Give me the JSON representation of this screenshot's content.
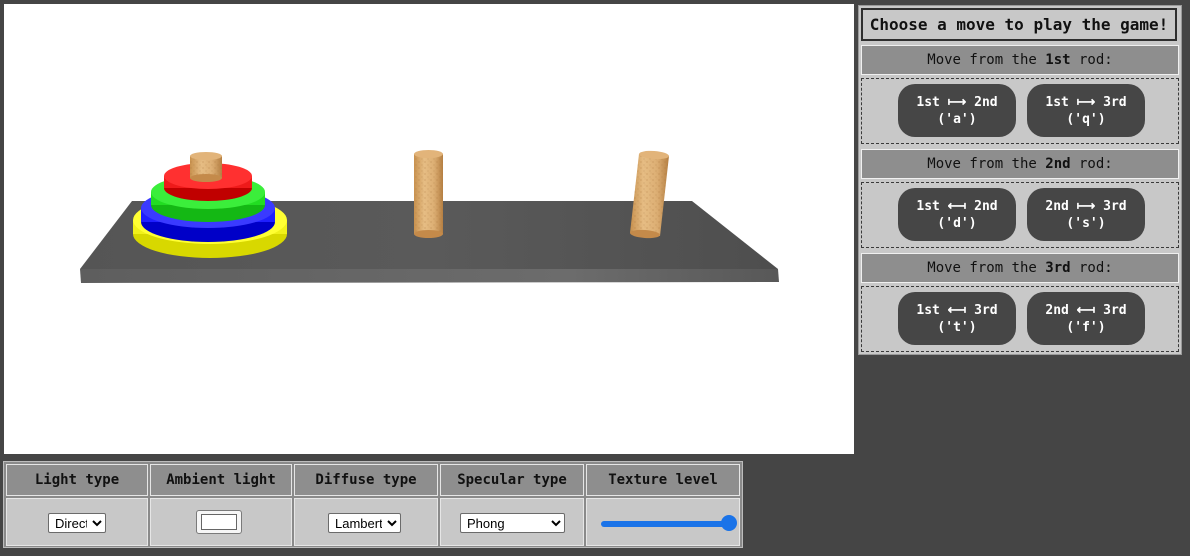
{
  "game": {
    "rods": [
      {
        "disks": [
          "yellow",
          "blue",
          "green",
          "red"
        ]
      },
      {
        "disks": []
      },
      {
        "disks": []
      }
    ],
    "colors": {
      "board": "#555555",
      "yellow": "#ffff1a",
      "blue": "#1a1aff",
      "green": "#22dd22",
      "red": "#ee1a1a",
      "peg": "#d8a96a"
    }
  },
  "panel": {
    "title": "Choose a move to play the game!",
    "sections": [
      {
        "header_prefix": "Move from the ",
        "header_rod": "1st",
        "header_suffix": " rod:",
        "buttons": [
          {
            "line1": "1st ⟼ 2nd",
            "line2": "('a')"
          },
          {
            "line1": "1st ⟼ 3rd",
            "line2": "('q')"
          }
        ]
      },
      {
        "header_prefix": "Move from the ",
        "header_rod": "2nd",
        "header_suffix": " rod:",
        "buttons": [
          {
            "line1": "1st ⟻ 2nd",
            "line2": "('d')"
          },
          {
            "line1": "2nd ⟼ 3rd",
            "line2": "('s')"
          }
        ]
      },
      {
        "header_prefix": "Move from the ",
        "header_rod": "3rd",
        "header_suffix": " rod:",
        "buttons": [
          {
            "line1": "1st ⟻ 3rd",
            "line2": "('t')"
          },
          {
            "line1": "2nd ⟻ 3rd",
            "line2": "('f')"
          }
        ]
      }
    ]
  },
  "controls": {
    "light_type": {
      "label": "Light type",
      "value": "Direct"
    },
    "ambient_light": {
      "label": "Ambient light",
      "color": "#ffffff"
    },
    "diffuse_type": {
      "label": "Diffuse type",
      "value": "Lambert"
    },
    "specular_type": {
      "label": "Specular type",
      "value": "Phong"
    },
    "texture_level": {
      "label": "Texture level",
      "value": 1.0
    }
  }
}
